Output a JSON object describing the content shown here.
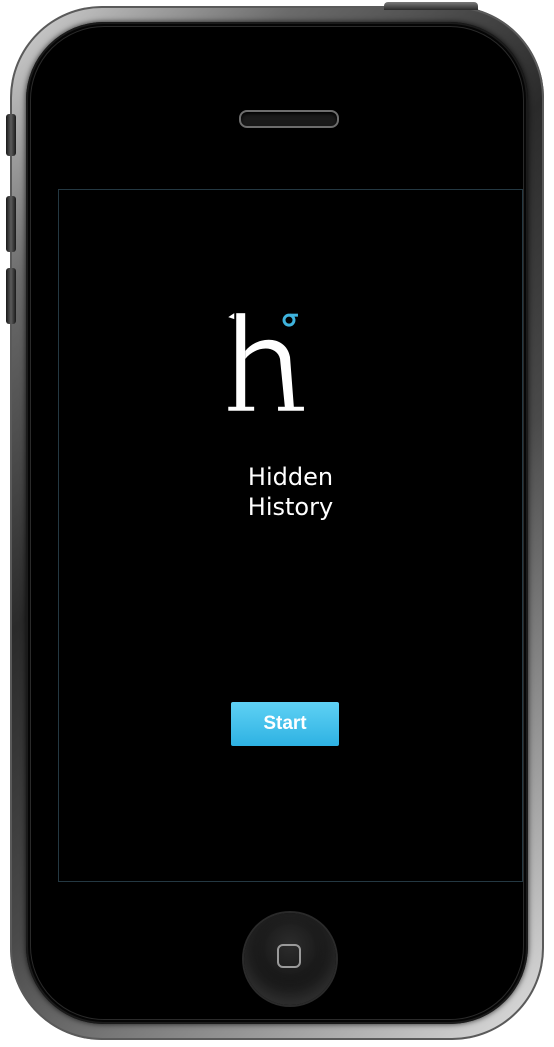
{
  "device": {
    "icons": {
      "speaker": "speaker-grille",
      "home": "home-button-icon"
    }
  },
  "app": {
    "logo_icon": "hidden-history-h-logo-icon",
    "title_line1": "Hidden",
    "title_line2": "History",
    "start_label": "Start"
  },
  "colors": {
    "accent": "#3fc0ec",
    "logo_white": "#ffffff",
    "logo_circle": "#3fb3dd",
    "screen_border": "#243842",
    "background": "#000000"
  }
}
